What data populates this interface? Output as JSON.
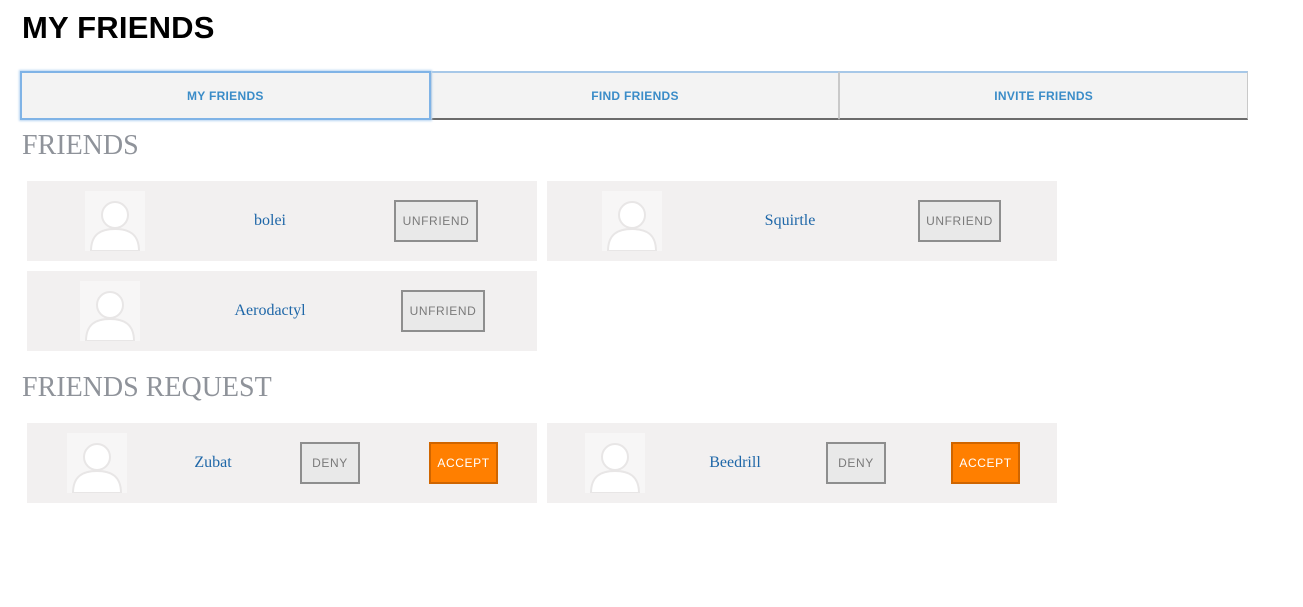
{
  "page": {
    "title": "MY FRIENDS"
  },
  "tabs": [
    {
      "label": "MY FRIENDS"
    },
    {
      "label": "FIND FRIENDS"
    },
    {
      "label": "INVITE FRIENDS"
    }
  ],
  "friends_section": {
    "heading": "FRIENDS",
    "items": [
      {
        "name": "bolei",
        "action_label": "UNFRIEND",
        "avatar": "user-silhouette-icon"
      },
      {
        "name": "Squirtle",
        "action_label": "UNFRIEND",
        "avatar": "user-silhouette-icon"
      },
      {
        "name": "Aerodactyl",
        "action_label": "UNFRIEND",
        "avatar": "user-silhouette-icon"
      }
    ]
  },
  "requests_section": {
    "heading": "FRIENDS REQUEST",
    "items": [
      {
        "name": "Zubat",
        "deny_label": "DENY",
        "accept_label": "ACCEPT",
        "avatar": "user-silhouette-icon"
      },
      {
        "name": "Beedrill",
        "deny_label": "DENY",
        "accept_label": "ACCEPT",
        "avatar": "user-silhouette-icon"
      }
    ]
  },
  "colors": {
    "tab_text": "#3a8cc8",
    "link": "#1f67a8",
    "heading_gray": "#8f939a",
    "card_bg": "#f2f0f0",
    "accept_orange": "#ff7f00"
  }
}
